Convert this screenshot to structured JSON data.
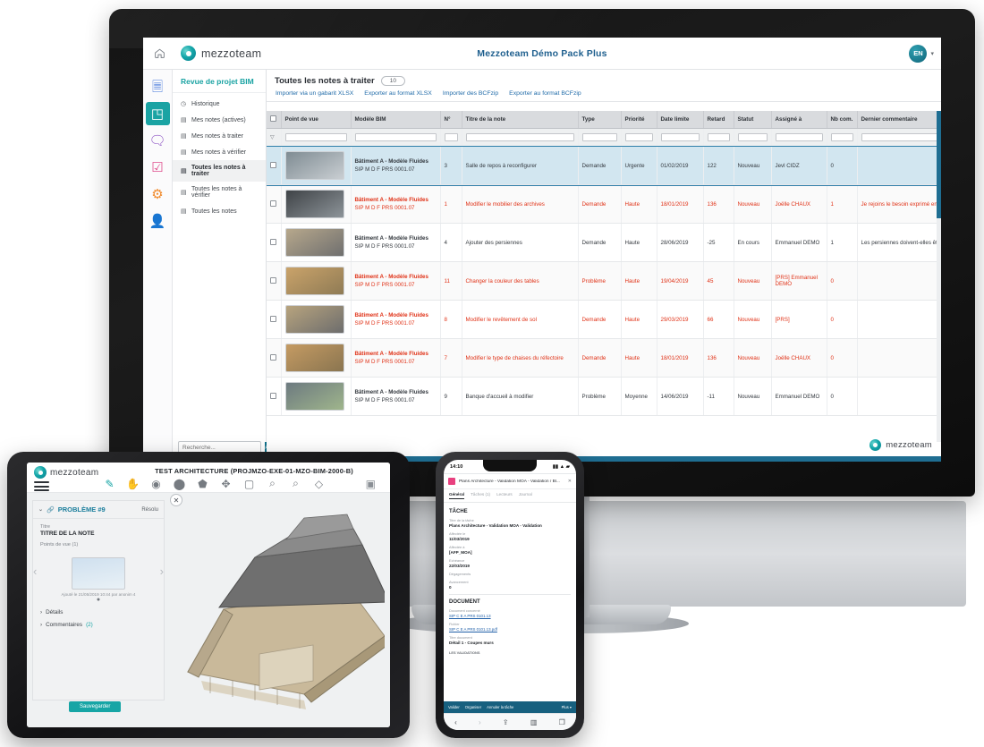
{
  "desktop": {
    "app_title": "Mezzoteam Démo Pack Plus",
    "brand": "mezzoteam",
    "home_icon": "home-icon",
    "avatar_initials": "EN",
    "caret": "▾",
    "rail_items": [
      {
        "name": "documents-icon",
        "glyph": "🗏",
        "color": "#3a6fd8",
        "active": false
      },
      {
        "name": "bim-cube-icon",
        "glyph": "◳",
        "color": "#ffffff",
        "active": true
      },
      {
        "name": "forum-icon",
        "glyph": "🗨",
        "color": "#8a4fc2",
        "active": false
      },
      {
        "name": "tasks-icon",
        "glyph": "☑",
        "color": "#e0518f",
        "active": false
      },
      {
        "name": "settings-gear-icon",
        "glyph": "⚙",
        "color": "#f08a2c",
        "active": false
      },
      {
        "name": "contacts-icon",
        "glyph": "👤",
        "color": "#5cba6a",
        "active": false
      }
    ],
    "nav": {
      "title": "Revue de projet BIM",
      "items": [
        {
          "label": "Historique",
          "icon": "clock-icon",
          "selected": false
        },
        {
          "label": "Mes notes (actives)",
          "icon": "note-icon",
          "selected": false
        },
        {
          "label": "Mes notes à traiter",
          "icon": "note-icon",
          "selected": false
        },
        {
          "label": "Mes notes à vérifier",
          "icon": "note-icon",
          "selected": false
        },
        {
          "label": "Toutes les notes à traiter",
          "icon": "note-icon",
          "selected": true
        },
        {
          "label": "Toutes les notes à vérifier",
          "icon": "note-icon",
          "selected": false
        },
        {
          "label": "Toutes les notes",
          "icon": "note-icon",
          "selected": false
        }
      ],
      "search_placeholder": "Recherche...",
      "search_icon": "search-icon"
    },
    "content": {
      "title": "Toutes les notes à traiter",
      "count": "10",
      "toolbar": [
        "Importer via un gabarit XLSX",
        "Exporter au format XLSX",
        "Importer des BCFzip",
        "Exporter au format BCFzip"
      ],
      "export_icon": "export-page-icon",
      "filter_icon": "filter-funnel-icon",
      "columns": [
        "",
        "Point de vue",
        "Modèle BIM",
        "N°",
        "Titre de la note",
        "Type",
        "Priorité",
        "Date limite",
        "Retard",
        "Statut",
        "Assigné à",
        "Nb com.",
        "Dernier commentaire"
      ],
      "rows": [
        {
          "model": "Bâtiment A - Modèle Fluides",
          "ref": "SIP M D F PRS 0001.07",
          "num": "3",
          "titre": "Salle de repos à reconfigurer",
          "type": "Demande",
          "priorite": "Urgente",
          "date": "01/02/2019",
          "retard": "122",
          "statut": "Nouveau",
          "assigne": "Jevl CIDZ",
          "nb": "0",
          "commentaire": "",
          "red": false,
          "selected": true
        },
        {
          "model": "Bâtiment A - Modèle Fluides",
          "ref": "SIP M D F PRS 0001.07",
          "num": "1",
          "titre": "Modifier le mobilier des archives",
          "type": "Demande",
          "priorite": "Haute",
          "date": "18/01/2019",
          "retard": "136",
          "statut": "Nouveau",
          "assigne": "Joëlle CHAUX",
          "nb": "1",
          "commentaire": "Je rejoins le besoin exprimé en r",
          "red": true,
          "selected": false
        },
        {
          "model": "Bâtiment A - Modèle Fluides",
          "ref": "SIP M D F PRS 0001.07",
          "num": "4",
          "titre": "Ajouter des persiennes",
          "type": "Demande",
          "priorite": "Haute",
          "date": "28/06/2019",
          "retard": "-25",
          "statut": "En cours",
          "assigne": "Emmanuel DEMO",
          "nb": "1",
          "commentaire": "Les persiennes doivent-elles être couleur ?",
          "red": false,
          "selected": false
        },
        {
          "model": "Bâtiment A - Modèle Fluides",
          "ref": "SIP M D F PRS 0001.07",
          "num": "11",
          "titre": "Changer la couleur des tables",
          "type": "Problème",
          "priorite": "Haute",
          "date": "19/04/2019",
          "retard": "45",
          "statut": "Nouveau",
          "assigne": "[PRS] Emmanuel DEMO",
          "nb": "0",
          "commentaire": "",
          "red": true,
          "selected": false
        },
        {
          "model": "Bâtiment A - Modèle Fluides",
          "ref": "SIP M D F PRS 0001.07",
          "num": "8",
          "titre": "Modifier le revêtement de sol",
          "type": "Demande",
          "priorite": "Haute",
          "date": "29/03/2019",
          "retard": "66",
          "statut": "Nouveau",
          "assigne": "[PRS]",
          "nb": "0",
          "commentaire": "",
          "red": true,
          "selected": false
        },
        {
          "model": "Bâtiment A - Modèle Fluides",
          "ref": "SIP M D F PRS 0001.07",
          "num": "7",
          "titre": "Modifier le type de chaises du réfectoire",
          "type": "Demande",
          "priorite": "Haute",
          "date": "18/01/2019",
          "retard": "136",
          "statut": "Nouveau",
          "assigne": "Joëlle CHAUX",
          "nb": "0",
          "commentaire": "",
          "red": true,
          "selected": false
        },
        {
          "model": "Bâtiment A - Modèle Fluides",
          "ref": "SIP M D F PRS 0001.07",
          "num": "9",
          "titre": "Banque d'accueil à modifier",
          "type": "Problème",
          "priorite": "Moyenne",
          "date": "14/06/2019",
          "retard": "-11",
          "statut": "Nouveau",
          "assigne": "Emmanuel DEMO",
          "nb": "0",
          "commentaire": "",
          "red": false,
          "selected": false
        }
      ]
    },
    "footer_brand": "mezzoteam"
  },
  "tablet": {
    "brand": "mezzoteam",
    "menu_icon": "hamburger-menu-icon",
    "title": "TEST ARCHITECTURE (PROJMZO-EXE-01-MZO-BIM-2000-B)",
    "tools": [
      {
        "name": "select-pointer-icon",
        "glyph": "✎",
        "active": true
      },
      {
        "name": "hand-pan-icon",
        "glyph": "✋",
        "active": false
      },
      {
        "name": "eye-visibility-icon",
        "glyph": "◉",
        "active": false
      },
      {
        "name": "orbit-sphere-icon",
        "glyph": "⬤",
        "active": false
      },
      {
        "name": "section-cut-icon",
        "glyph": "⬟",
        "active": false
      },
      {
        "name": "move-axis-icon",
        "glyph": "✥",
        "active": false
      },
      {
        "name": "box-view-icon",
        "glyph": "▢",
        "active": false
      },
      {
        "name": "zoom-in-icon",
        "glyph": "⌕",
        "active": false
      },
      {
        "name": "zoom-out-icon",
        "glyph": "⌕",
        "active": false
      },
      {
        "name": "model-tree-icon",
        "glyph": "◇",
        "active": false
      }
    ],
    "camera_icon": "camera-icon",
    "close_icon": "close-icon",
    "panel": {
      "title": "PROBLÈME #9",
      "status": "Résolu",
      "expand_icon": "chevron-down-icon",
      "link_icon": "link-icon",
      "title_label": "Titre",
      "title_value": "TITRE DE LA NOTE",
      "viewpoints_label": "Points de vue (1)",
      "viewpoint_caption": "Ajouté le 21/05/2019 10:44 par anonim 4",
      "prev_icon": "chevron-left-icon",
      "next_icon": "chevron-right-icon",
      "accordions": [
        {
          "label": "Détails",
          "count": ""
        },
        {
          "label": "Commentaires",
          "count": "(2)"
        }
      ],
      "save_label": "Sauvegarder"
    }
  },
  "phone": {
    "time": "14:10",
    "status_icons": "signal-wifi-battery-icon",
    "doc_title": "Plans Architecture - Validation MOA - Validation / Bl...",
    "close_icon": "close-icon",
    "tabs": [
      {
        "label": "Général",
        "active": true
      },
      {
        "label": "Tâches (1)",
        "active": false
      },
      {
        "label": "Lecteurs",
        "active": false
      },
      {
        "label": "Journal",
        "active": false
      }
    ],
    "section_task": "TÂCHE",
    "fields": [
      {
        "label": "Titre de la tâche",
        "value": "Plans Architecture - Validation MOA - Validation"
      },
      {
        "label": "Affectée le",
        "value": "11/03/2019"
      },
      {
        "label": "Affectée à",
        "value": "[AFP_MOA]"
      },
      {
        "label": "Echéance",
        "value": "22/03/2019"
      },
      {
        "label": "Dégagements",
        "value": ""
      },
      {
        "label": "Avancement",
        "value": "0"
      }
    ],
    "section_document": "DOCUMENT",
    "doc_fields": [
      {
        "label": "Document concerné",
        "link": "SIP C E A PRS 0101.13"
      },
      {
        "label": "Fichier",
        "link": "SIP C E A PRS 0101.13.pdf"
      },
      {
        "label": "Titre document",
        "value": "Détail 1 - Coupes murs"
      }
    ],
    "workflow_label": "LES VALIDATIONS",
    "actions": [
      "Valider",
      "Organiser",
      "Annuler la tâche",
      "Plus ▾"
    ],
    "nav_icons": [
      "back-chevron-icon",
      "forward-chevron-icon",
      "share-icon",
      "bookmarks-icon",
      "tabs-icon"
    ]
  }
}
